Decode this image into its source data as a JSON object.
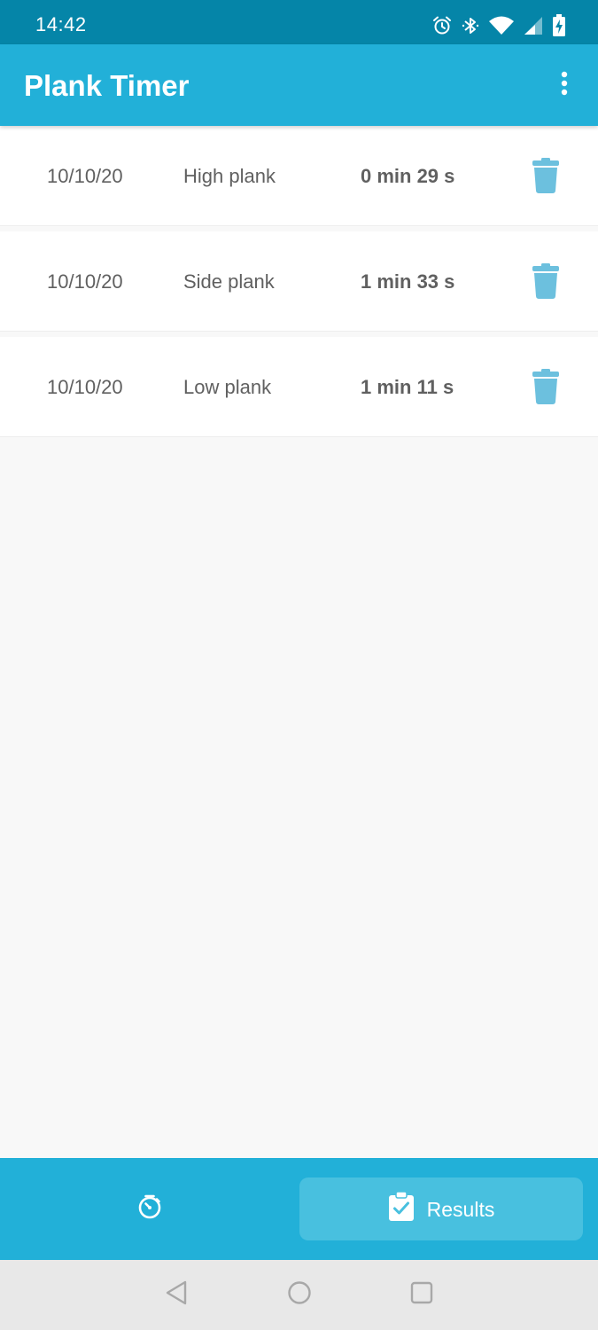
{
  "status_bar": {
    "time": "14:42",
    "icons": [
      "alarm-icon",
      "bluetooth-icon",
      "wifi-icon",
      "cell-signal-icon",
      "battery-charging-icon"
    ]
  },
  "app_bar": {
    "title": "Plank Timer",
    "menu_icon": "overflow-menu-icon"
  },
  "results": [
    {
      "date": "10/10/20",
      "type": "High plank",
      "duration": "0 min 29 s",
      "delete_icon": "trash-icon"
    },
    {
      "date": "10/10/20",
      "type": "Side plank",
      "duration": "1 min 33 s",
      "delete_icon": "trash-icon"
    },
    {
      "date": "10/10/20",
      "type": "Low plank",
      "duration": "1 min 11 s",
      "delete_icon": "trash-icon"
    }
  ],
  "bottom_nav": {
    "timer_icon": "stopwatch-icon",
    "results_label": "Results",
    "results_icon": "clipboard-check-icon",
    "active_tab": "Results"
  },
  "system_nav": {
    "icons": [
      "back-icon",
      "home-icon",
      "recents-icon"
    ]
  },
  "colors": {
    "status_bar": "#0585a8",
    "app_bar": "#22b0d8",
    "active_tab_highlight": "#48c0df",
    "trash_icon": "#6cc0de",
    "list_text": "#606060",
    "page_background": "#f8f8f8",
    "system_nav": "#e8e8e8"
  }
}
